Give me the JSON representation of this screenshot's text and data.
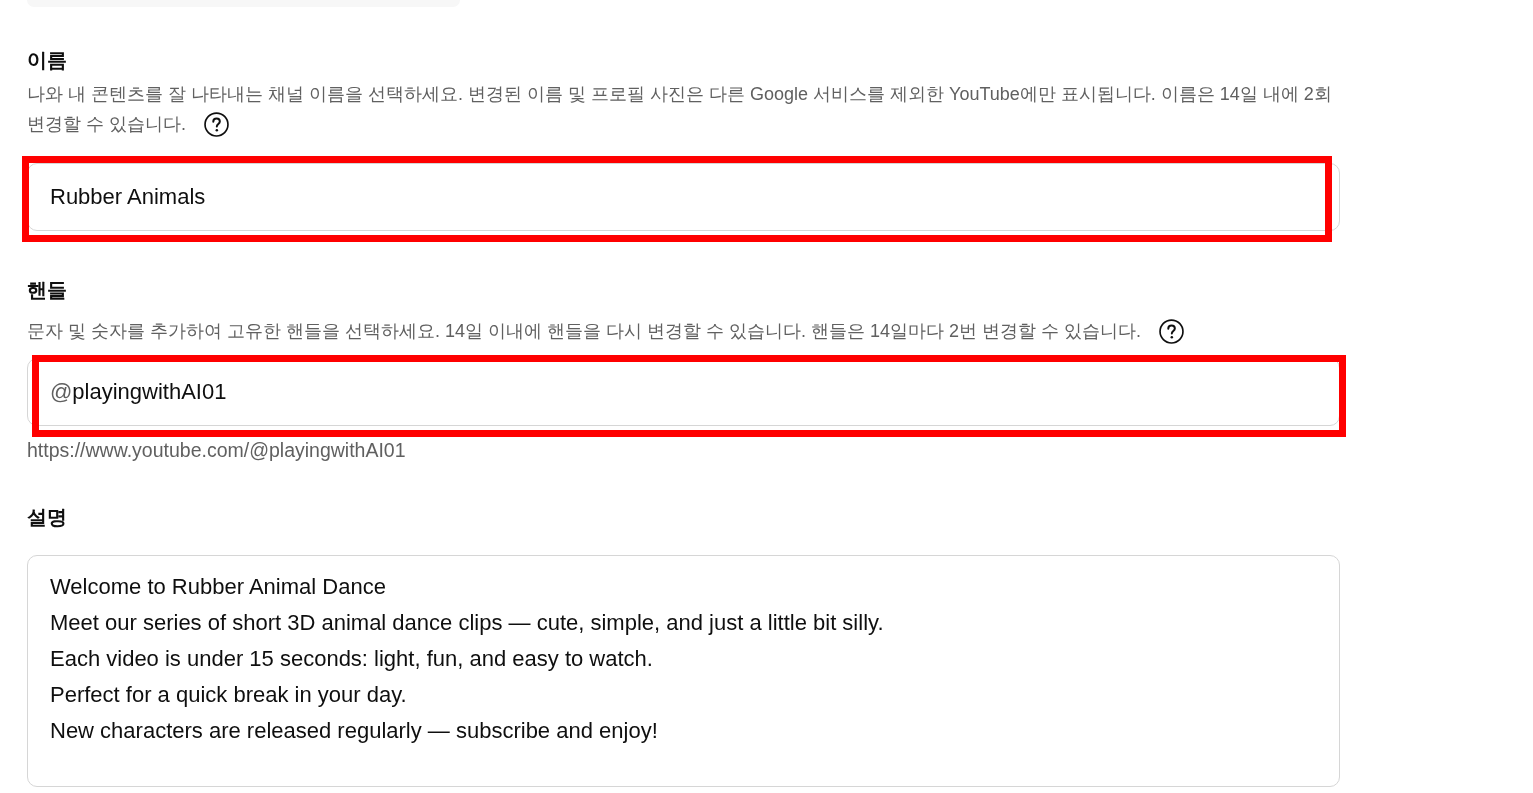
{
  "fields": [
    {
      "kind": "text",
      "label": "이름",
      "help": [
        "나와 내 콘텐츠를 잘 나타내는 채널 이름을 선택하세요. 변경된 이름 및 프로필 사진은 다른 Google 서비스를 제외한 YouTube에만 표시됩니다. 이름은 14일 내에 2회",
        "변경할 수 있습니다."
      ],
      "value": "Rubber Animals",
      "highlighted": true
    },
    {
      "kind": "handle",
      "label": "핸들",
      "help": [
        "문자 및 숫자를 추가하여 고유한 핸들을 선택하세요. 14일 이내에 핸들을 다시 변경할 수 있습니다. 핸들은 14일마다 2번 변경할 수 있습니다."
      ],
      "prefix": "@",
      "value": "playingwithAI01",
      "url": "https://www.youtube.com/@playingwithAI01",
      "highlighted": true
    },
    {
      "kind": "textarea",
      "label": "설명",
      "value": "Welcome to Rubber Animal Dance\nMeet our series of short 3D animal dance clips — cute, simple, and just a little bit silly.\nEach video is under 15 seconds: light, fun, and easy to watch.\nPerfect for a quick break in your day.\nNew characters are released regularly — subscribe and enjoy!",
      "highlighted": false
    }
  ]
}
